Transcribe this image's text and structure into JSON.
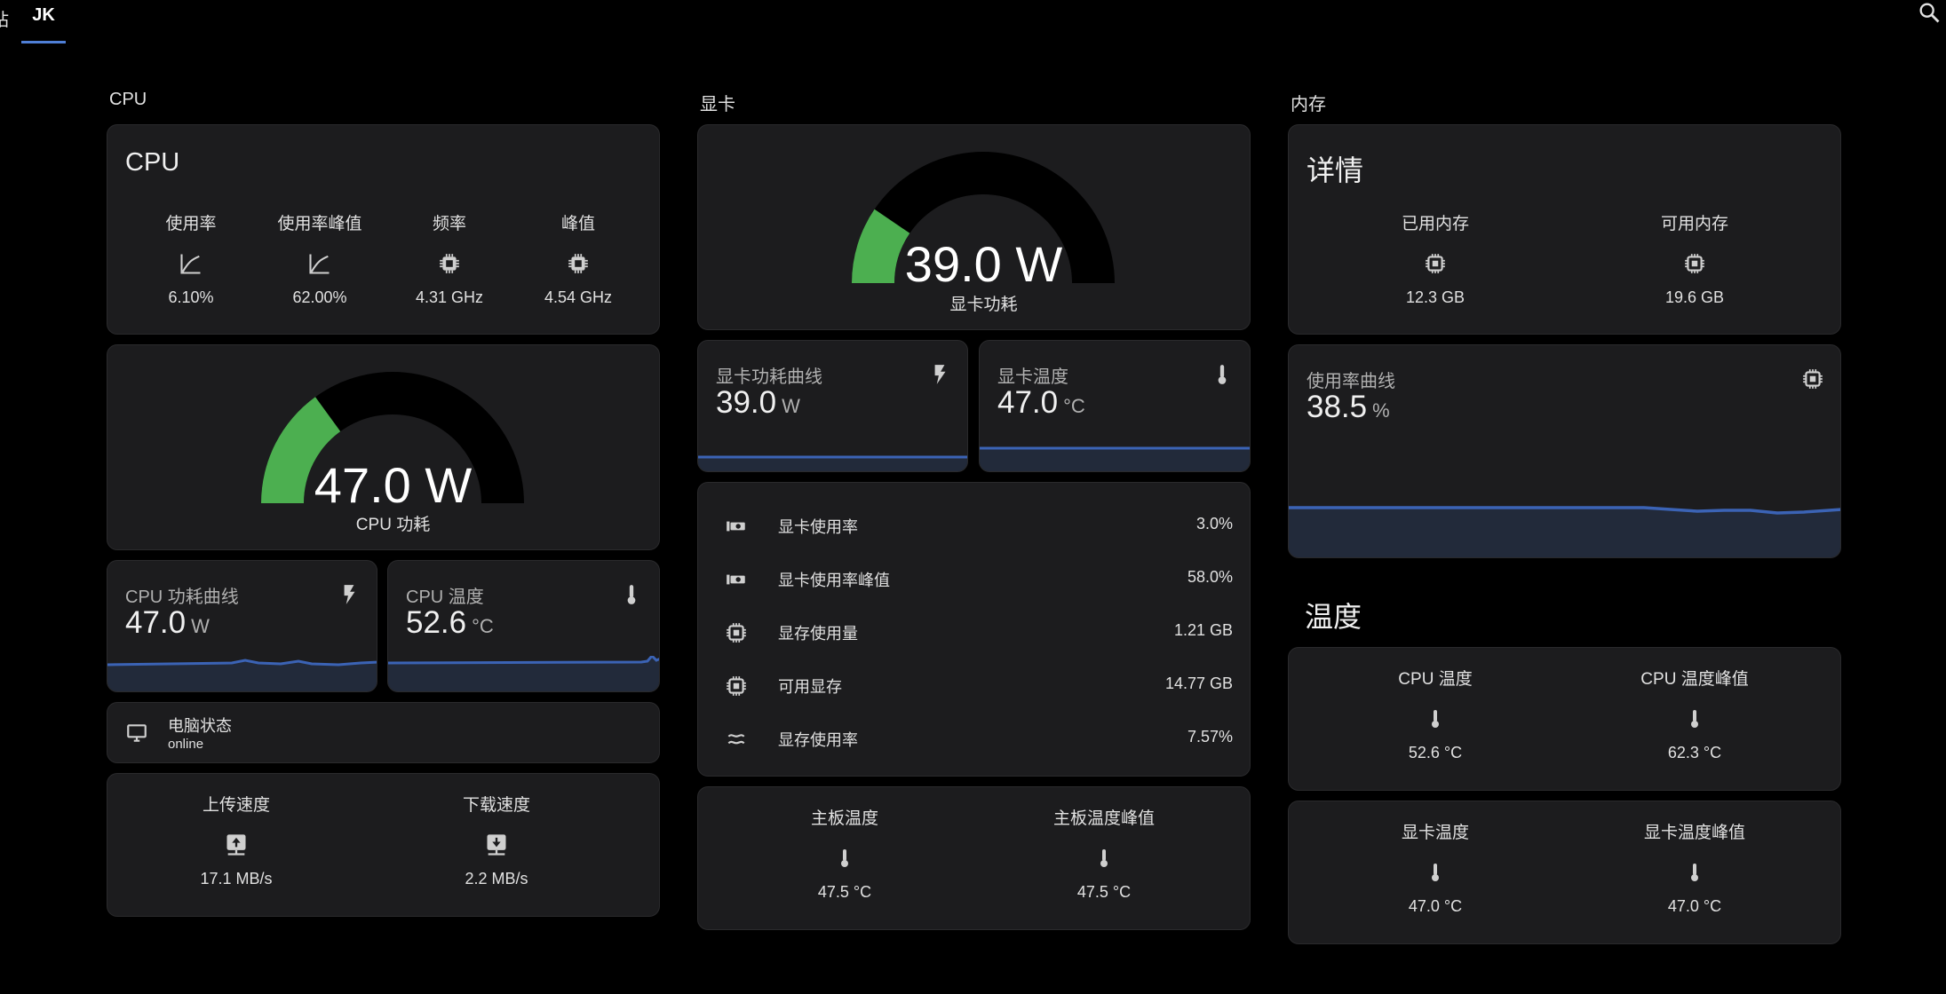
{
  "tabs": [
    {
      "label": "站"
    },
    {
      "label": "JK"
    }
  ],
  "columns": {
    "cpu": "CPU",
    "gpu": "显卡",
    "mem": "内存"
  },
  "cpu_card": {
    "title": "CPU",
    "stats": [
      {
        "name": "使用率",
        "icon": "chart-line-icon",
        "value": "6.10%"
      },
      {
        "name": "使用率峰值",
        "icon": "chart-line-icon",
        "value": "62.00%"
      },
      {
        "name": "频率",
        "icon": "chip-icon",
        "value": "4.31 GHz"
      },
      {
        "name": "峰值",
        "icon": "chip-icon",
        "value": "4.54 GHz"
      }
    ]
  },
  "cpu_gauge": {
    "value": "47.0 W",
    "label": "CPU 功耗",
    "fraction": 0.3
  },
  "cpu_power_curve": {
    "name": "CPU 功耗曲线",
    "value": "47.0",
    "unit": "W"
  },
  "cpu_temp": {
    "name": "CPU 温度",
    "value": "52.6",
    "unit": "°C"
  },
  "pc_status": {
    "name": "电脑状态",
    "state": "online"
  },
  "network": {
    "upload": {
      "name": "上传速度",
      "value": "17.1 MB/s"
    },
    "download": {
      "name": "下载速度",
      "value": "2.2 MB/s"
    }
  },
  "gpu_gauge": {
    "value": "39.0 W",
    "label": "显卡功耗",
    "fraction": 0.19
  },
  "gpu_power_curve": {
    "name": "显卡功耗曲线",
    "value": "39.0",
    "unit": "W"
  },
  "gpu_temp": {
    "name": "显卡温度",
    "value": "47.0",
    "unit": "°C"
  },
  "gpu_rows": [
    {
      "icon": "gpu-card-icon",
      "label": "显卡使用率",
      "value": "3.0%"
    },
    {
      "icon": "gpu-card-icon",
      "label": "显卡使用率峰值",
      "value": "58.0%"
    },
    {
      "icon": "chip-icon",
      "label": "显存使用量",
      "value": "1.21 GB"
    },
    {
      "icon": "chip-icon",
      "label": "可用显存",
      "value": "14.77 GB"
    },
    {
      "icon": "approx-icon",
      "label": "显存使用率",
      "value": "7.57%"
    }
  ],
  "board": {
    "temp": {
      "name": "主板温度",
      "value": "47.5 °C"
    },
    "temp_peak": {
      "name": "主板温度峰值",
      "value": "47.5 °C"
    }
  },
  "mem_card": {
    "title": "详情",
    "used": {
      "name": "已用内存",
      "value": "12.3 GB"
    },
    "free": {
      "name": "可用内存",
      "value": "19.6 GB"
    }
  },
  "mem_usage_curve": {
    "name": "使用率曲线",
    "value": "38.5",
    "unit": "%"
  },
  "temps_section": {
    "title": "温度"
  },
  "temps_cpu": {
    "temp": {
      "name": "CPU 温度",
      "value": "52.6 °C"
    },
    "peak": {
      "name": "CPU 温度峰值",
      "value": "62.3 °C"
    }
  },
  "temps_gpu": {
    "temp": {
      "name": "显卡温度",
      "value": "47.0 °C"
    },
    "peak": {
      "name": "显卡温度峰值",
      "value": "47.0 °C"
    }
  },
  "colors": {
    "accent": "#4f7fd6",
    "gauge_fill": "#4caf50",
    "card": "#1c1c1e",
    "spark_line": "#3b63b5"
  }
}
